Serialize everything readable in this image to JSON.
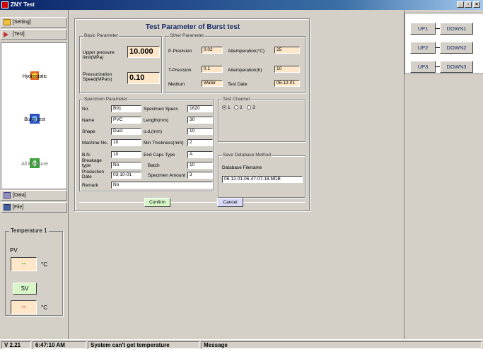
{
  "window": {
    "title": "ZNY Test"
  },
  "sidebar": {
    "setting_label": "[Setting]",
    "test_label": "[Test]",
    "data_label": "[Data]",
    "file_label": "[File]",
    "tests": [
      "Hydrostatic",
      "Burst test",
      "All Pressure"
    ],
    "temperature": {
      "title": "Temperature 1",
      "pv_label": "PV",
      "pv_value": "--",
      "sv_button": "SV",
      "sv_value": "--",
      "unit": "°C"
    }
  },
  "dialog": {
    "title": "Test Parameter of Burst test",
    "basic": {
      "legend": "Basic Parameter",
      "upper_pressure_label": "Upper pressure limit(MPa)",
      "upper_pressure_value": "10.000",
      "speed_label": "Pressurization Speed(MPa/s)",
      "speed_value": "0.10"
    },
    "other": {
      "legend": "Other Parameter",
      "p_precision_label": "P-Precision",
      "p_precision_value": "0.02",
      "attemp_c_label": "Attemperation(°C)",
      "attemp_c_value": "25",
      "t_precision_label": "T-Precision",
      "t_precision_value": "0.1",
      "attemp_h_label": "Attemperation(h)",
      "attemp_h_value": "10",
      "medium_label": "Medium",
      "medium_value": "Water",
      "test_date_label": "Test Date",
      "test_date_value": "06-12-01"
    },
    "specimen": {
      "legend": "Specimen Parameter",
      "no_label": "No.",
      "no_value": "B01",
      "specs_label": "Specimen Specs",
      "specs_value": "1620",
      "name_label": "Name",
      "name_value": "PVC",
      "length_label": "Length(mm)",
      "length_value": "30",
      "shape_label": "Shape",
      "shape_value": "Duct",
      "od_label": "o.d.(mm)",
      "od_value": "10",
      "machine_label": "Machine No.",
      "machine_value": "10",
      "min_thick_label": "Min Thickness(mm)",
      "min_thick_value": "2",
      "bn_label": "B.N.",
      "bn_value": "10",
      "endcaps_label": "End Caps Type",
      "endcaps_value": "A",
      "breakage_label": "Breakage type",
      "breakage_value": "No",
      "batch_label": "Batch",
      "batch_value": "10",
      "prod_date_label": "Production Date",
      "prod_date_value": "03-10-01",
      "amount_label": "Specimen Amount",
      "amount_value": "3",
      "remark_label": "Remark",
      "remark_value": "No"
    },
    "channel": {
      "legend": "Test Channel",
      "options": [
        "1",
        "2",
        "3"
      ],
      "selected": "1"
    },
    "database": {
      "legend": "Save Database Method",
      "filename_label": "Database Filename",
      "filename_value": "06-12-01-06-47-07-18.MDB"
    },
    "confirm_label": "Confirm",
    "cancel_label": "Cancel"
  },
  "right_panel": {
    "rows": [
      {
        "up": "UP1",
        "down": "DOWN1"
      },
      {
        "up": "UP2",
        "down": "DOWN2"
      },
      {
        "up": "UP3",
        "down": "DOWN3"
      }
    ]
  },
  "statusbar": {
    "version": "V 2.21",
    "time": "6:47:10 AM",
    "status": "System can't get temperature",
    "message": "Message"
  },
  "colors": {
    "accent_field": "#fde7c8",
    "sv_button": "#d8f5c8",
    "confirm_button": "#d8f5c8",
    "cancel_button": "#d8d8f8",
    "title_text": "#1a2d66"
  }
}
